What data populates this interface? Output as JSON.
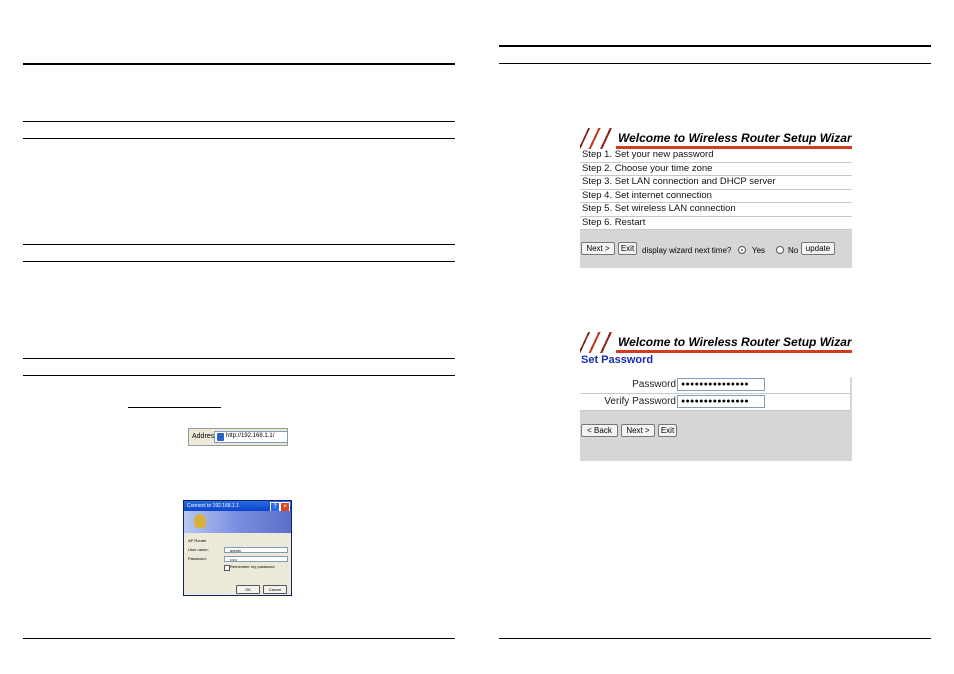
{
  "address_bar": {
    "label": "Address",
    "url": "http://192.168.1.1/"
  },
  "login_dialog": {
    "title": "Connect to 192.168.1.1",
    "realm": "AP Router",
    "user_label": "User name:",
    "user_value": "admin",
    "password_label": "Password:",
    "password_value": "•••••",
    "remember_label": "Remember my password",
    "ok_label": "OK",
    "cancel_label": "Cancel"
  },
  "wizard_steps": {
    "title": "Welcome to Wireless Router Setup Wizard",
    "steps": [
      "Step 1. Set your new password",
      "Step 2. Choose your time zone",
      "Step 3. Set LAN connection and DHCP server",
      "Step 4. Set internet connection",
      "Step 5. Set wireless LAN connection",
      "Step 6. Restart"
    ],
    "next_label": "Next >",
    "exit_label": "Exit",
    "display_prompt": "display wizard next time?",
    "yes_label": "Yes",
    "no_label": "No",
    "update_label": "update"
  },
  "wizard_password": {
    "title": "Welcome to Wireless Router Setup Wizard",
    "section_title": "Set Password",
    "password_label": "Password",
    "password_value": "●●●●●●●●●●●●●●●",
    "verify_label": "Verify Password",
    "verify_value": "●●●●●●●●●●●●●●●",
    "back_label": "< Back",
    "next_label": "Next >",
    "exit_label": "Exit"
  }
}
